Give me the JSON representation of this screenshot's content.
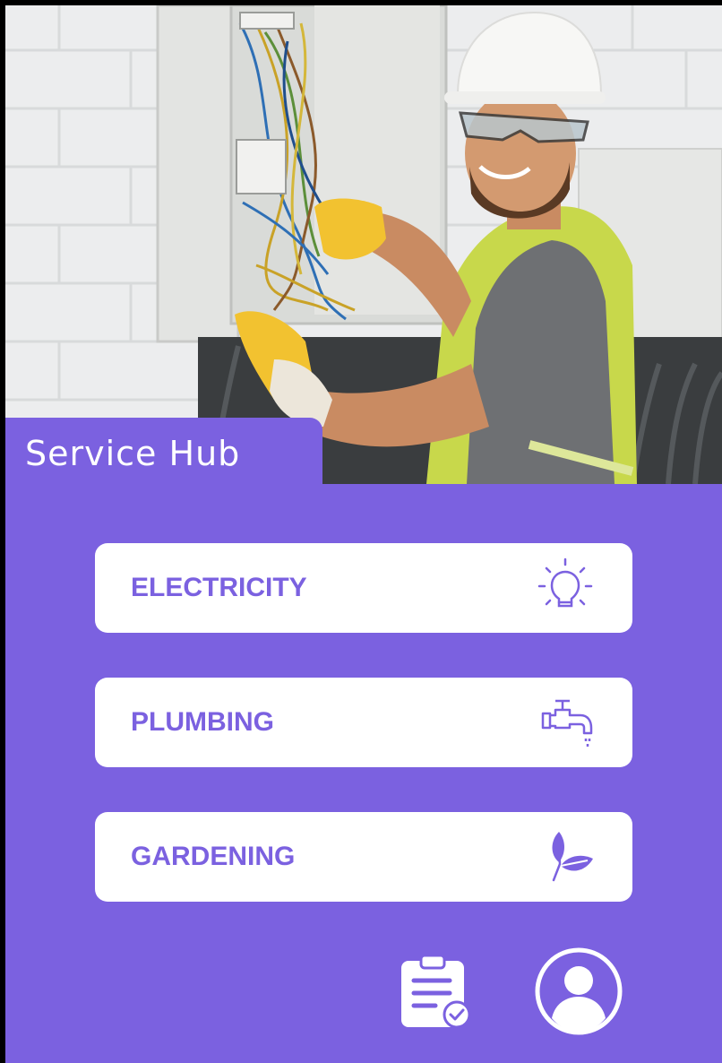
{
  "app": {
    "title": "Service Hub"
  },
  "services": [
    {
      "label": "ELECTRICITY",
      "icon": "lightbulb-icon"
    },
    {
      "label": "PLUMBING",
      "icon": "faucet-icon"
    },
    {
      "label": "GARDENING",
      "icon": "leaf-icon"
    }
  ],
  "bottom_nav": [
    {
      "icon": "clipboard-check-icon"
    },
    {
      "icon": "user-avatar-icon"
    }
  ],
  "colors": {
    "accent": "#7B61E0",
    "card": "#FFFFFF",
    "text_on_accent": "#FFFFFF"
  }
}
